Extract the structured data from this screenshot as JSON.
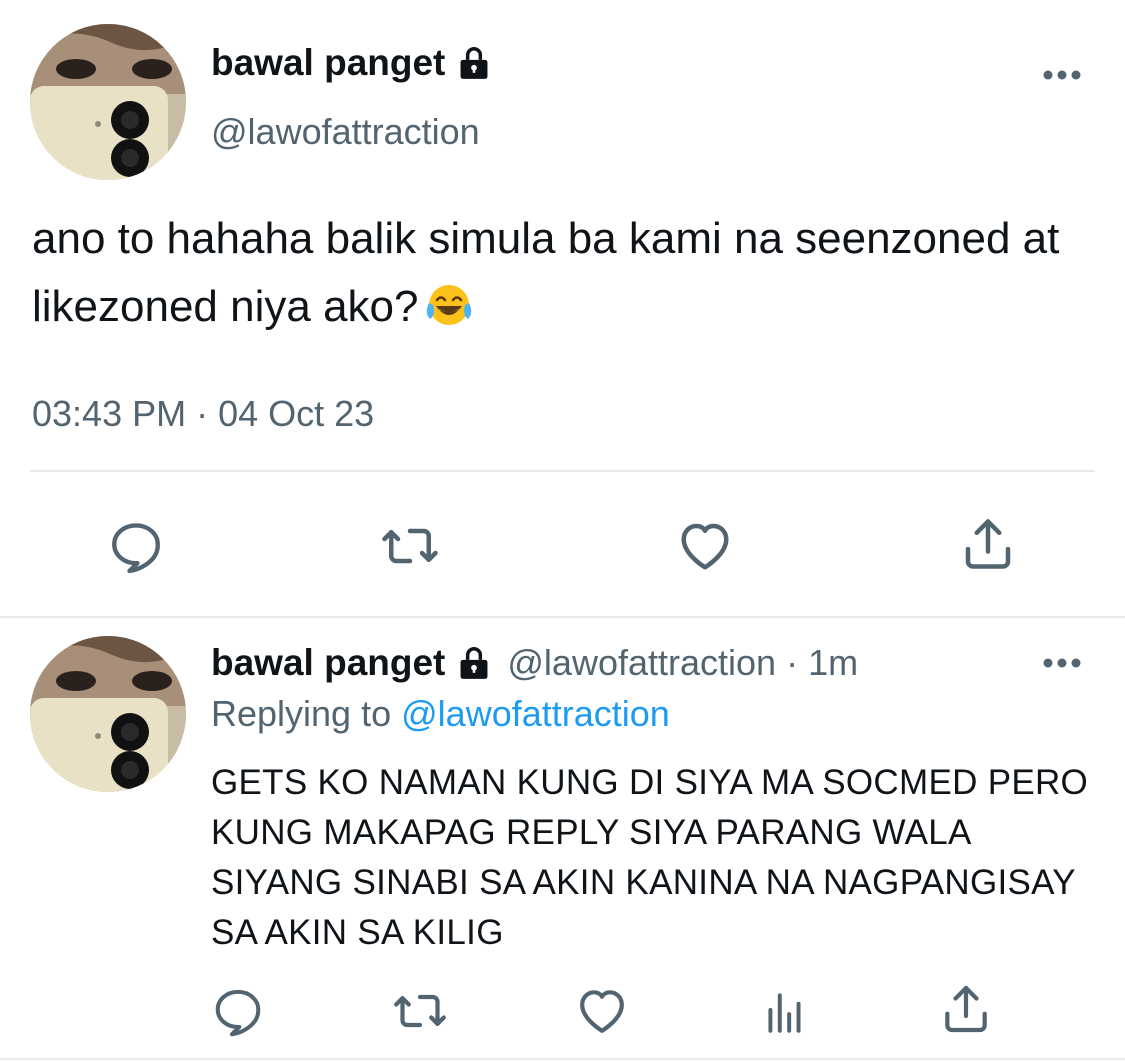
{
  "main_tweet": {
    "display_name": "bawal panget",
    "handle": "@lawofattraction",
    "text": "ano to hahaha balik simula ba kami na seenzoned at likezoned niya ako?",
    "emoji": "face-with-tears-of-joy-icon",
    "timestamp": "03:43 PM · 04 Oct 23",
    "actions": [
      "reply-icon",
      "retweet-icon",
      "like-icon",
      "share-icon"
    ]
  },
  "reply_tweet": {
    "display_name": "bawal panget",
    "handle": "@lawofattraction",
    "separator": "·",
    "time": "1m",
    "replying_to_label": "Replying to",
    "replying_to_handle": "@lawofattraction",
    "text": "GETS KO NAMAN KUNG DI SIYA MA SOCMED PERO KUNG MAKAPAG REPLY SIYA PARANG WALA SIYANG SINABI SA AKIN KANINA NA NAGPANGISAY SA AKIN SA KILIG",
    "actions": [
      "reply-icon",
      "retweet-icon",
      "like-icon",
      "analytics-icon",
      "share-icon"
    ]
  },
  "colors": {
    "text_primary": "#0f1419",
    "text_secondary": "#536471",
    "link": "#1d9bf0",
    "divider": "#e7e9ea",
    "icon": "#536471"
  }
}
